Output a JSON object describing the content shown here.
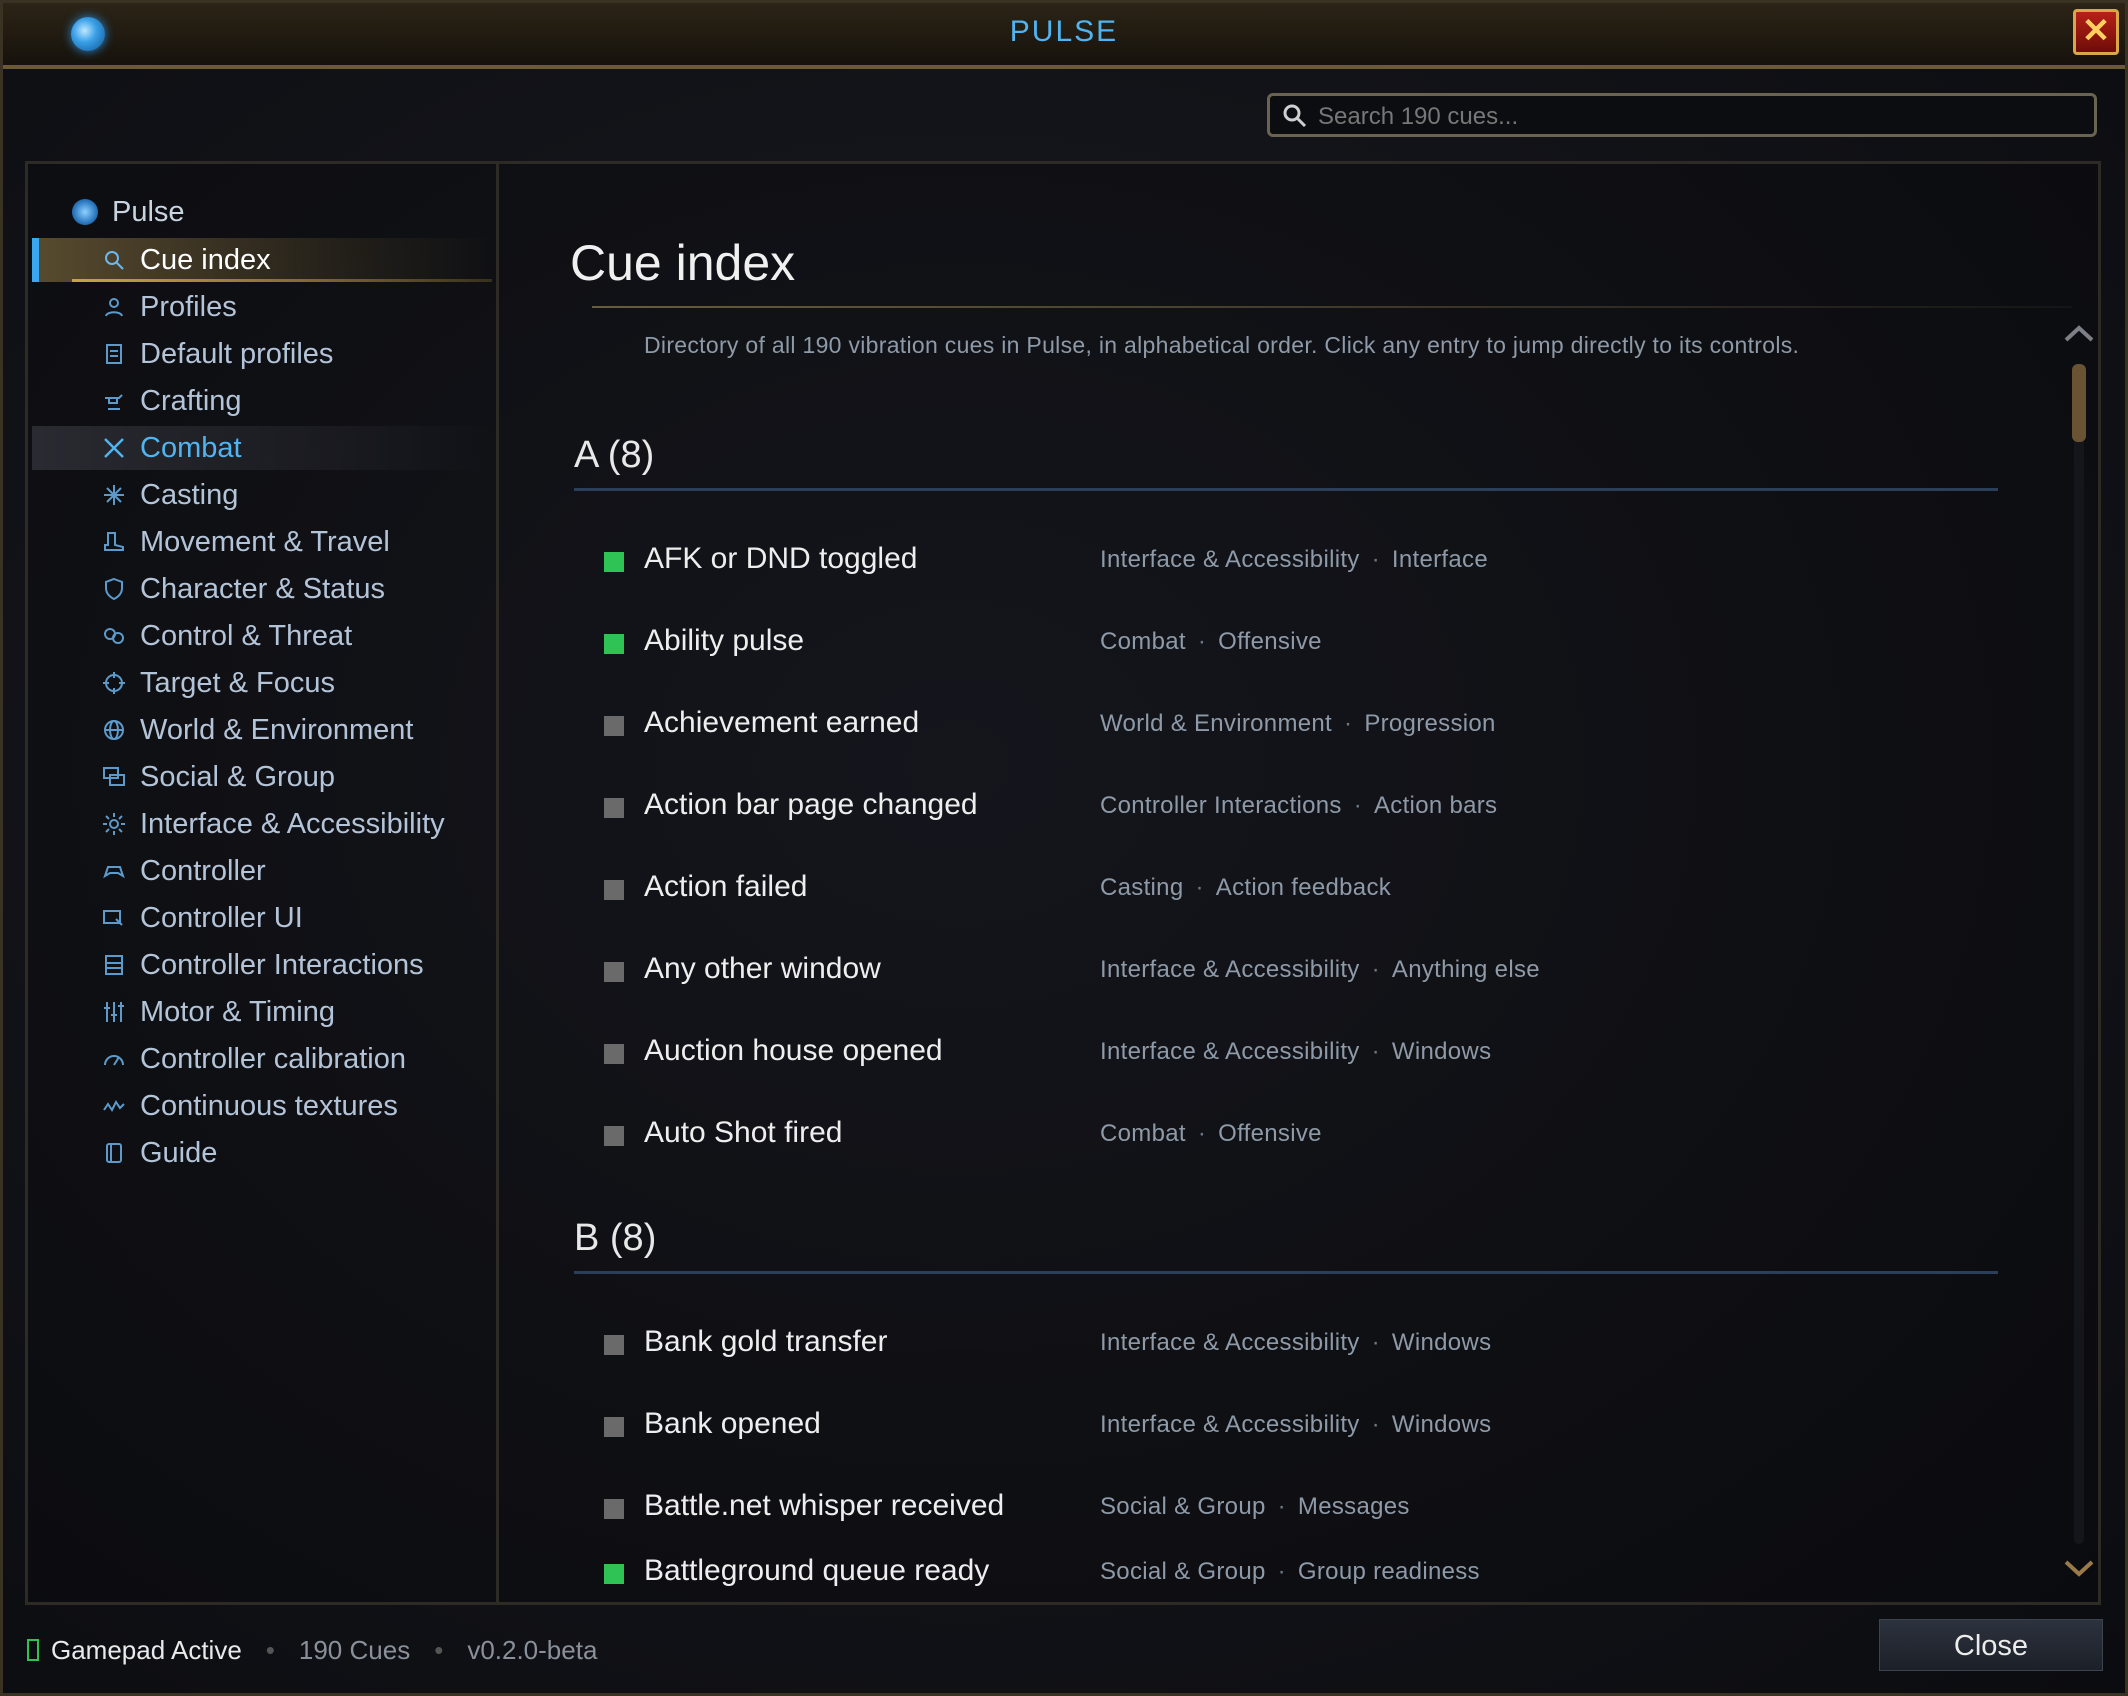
{
  "window": {
    "title": "PULSE"
  },
  "search": {
    "placeholder": "Search 190 cues..."
  },
  "sidebar": {
    "root": "Pulse",
    "items": [
      {
        "label": "Cue index",
        "icon": "search-icon"
      },
      {
        "label": "Profiles",
        "icon": "person-icon"
      },
      {
        "label": "Default profiles",
        "icon": "document-icon"
      },
      {
        "label": "Crafting",
        "icon": "anvil-icon"
      },
      {
        "label": "Combat",
        "icon": "crossed-swords-icon"
      },
      {
        "label": "Casting",
        "icon": "sparkle-icon"
      },
      {
        "label": "Movement & Travel",
        "icon": "boot-icon"
      },
      {
        "label": "Character & Status",
        "icon": "shield-icon"
      },
      {
        "label": "Control & Threat",
        "icon": "chain-icon"
      },
      {
        "label": "Target & Focus",
        "icon": "crosshair-icon"
      },
      {
        "label": "World & Environment",
        "icon": "globe-icon"
      },
      {
        "label": "Social & Group",
        "icon": "chat-icon"
      },
      {
        "label": "Interface & Accessibility",
        "icon": "gear-icon"
      },
      {
        "label": "Controller",
        "icon": "gamepad-icon"
      },
      {
        "label": "Controller UI",
        "icon": "window-icon"
      },
      {
        "label": "Controller Interactions",
        "icon": "grid-icon"
      },
      {
        "label": "Motor & Timing",
        "icon": "sliders-icon"
      },
      {
        "label": "Controller calibration",
        "icon": "gauge-icon"
      },
      {
        "label": "Continuous textures",
        "icon": "wave-icon"
      },
      {
        "label": "Guide",
        "icon": "book-icon"
      }
    ]
  },
  "main": {
    "title": "Cue index",
    "intro": "Directory of all 190 vibration cues in Pulse, in alphabetical order. Click any entry to jump directly to its controls.",
    "sections": [
      {
        "heading": "A (8)",
        "rows": [
          {
            "name": "AFK or DND toggled",
            "category": "Interface & Accessibility",
            "subcategory": "Interface",
            "enabled": true
          },
          {
            "name": "Ability pulse",
            "category": "Combat",
            "subcategory": "Offensive",
            "enabled": true
          },
          {
            "name": "Achievement earned",
            "category": "World & Environment",
            "subcategory": "Progression",
            "enabled": false
          },
          {
            "name": "Action bar page changed",
            "category": "Controller Interactions",
            "subcategory": "Action bars",
            "enabled": false
          },
          {
            "name": "Action failed",
            "category": "Casting",
            "subcategory": "Action feedback",
            "enabled": false
          },
          {
            "name": "Any other window",
            "category": "Interface & Accessibility",
            "subcategory": "Anything else",
            "enabled": false
          },
          {
            "name": "Auction house opened",
            "category": "Interface & Accessibility",
            "subcategory": "Windows",
            "enabled": false
          },
          {
            "name": "Auto Shot fired",
            "category": "Combat",
            "subcategory": "Offensive",
            "enabled": false
          }
        ]
      },
      {
        "heading": "B (8)",
        "rows": [
          {
            "name": "Bank gold transfer",
            "category": "Interface & Accessibility",
            "subcategory": "Windows",
            "enabled": false
          },
          {
            "name": "Bank opened",
            "category": "Interface & Accessibility",
            "subcategory": "Windows",
            "enabled": false
          },
          {
            "name": "Battle.net whisper received",
            "category": "Social & Group",
            "subcategory": "Messages",
            "enabled": false
          },
          {
            "name": "Battleground queue ready",
            "category": "Social & Group",
            "subcategory": "Group readiness",
            "enabled": true
          }
        ]
      }
    ]
  },
  "footer": {
    "gamepad": "Gamepad Active",
    "cues": "190 Cues",
    "version": "v0.2.0-beta",
    "close_label": "Close"
  },
  "colors": {
    "accent_blue": "#4fb4f0",
    "enabled_green": "#2fc254",
    "gold_border": "#6b5a34"
  }
}
